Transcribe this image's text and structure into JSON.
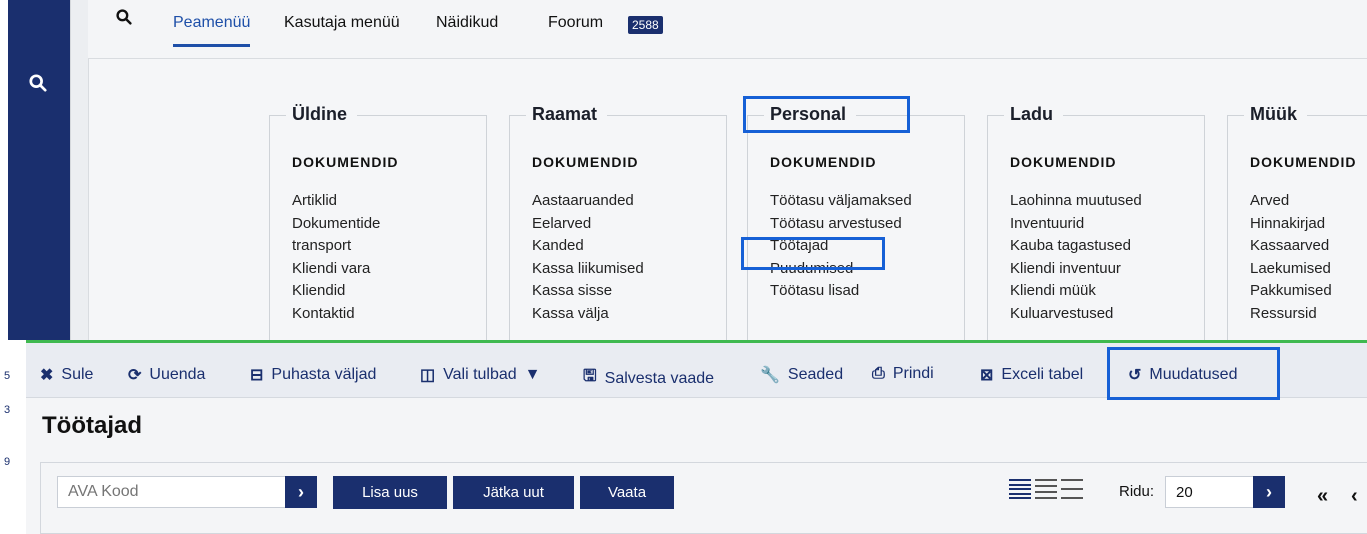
{
  "top_nav": {
    "tabs": [
      {
        "label": "Peamenüü"
      },
      {
        "label": "Kasutaja menüü"
      },
      {
        "label": "Näidikud"
      },
      {
        "label": "Foorum"
      }
    ],
    "badge": "2588"
  },
  "menu": {
    "columns": [
      {
        "title": "Üldine",
        "subtitle": "DOKUMENDID",
        "items": [
          "Artiklid",
          "Dokumentide",
          "transport",
          "Kliendi vara",
          "Kliendid",
          "Kontaktid"
        ]
      },
      {
        "title": "Raamat",
        "subtitle": "DOKUMENDID",
        "items": [
          "Aastaaruanded",
          "Eelarved",
          "Kanded",
          "Kassa liikumised",
          "Kassa sisse",
          "Kassa välja"
        ]
      },
      {
        "title": "Personal",
        "subtitle": "DOKUMENDID",
        "items": [
          "Töötasu väljamaksed",
          "Töötasu arvestused",
          "Töötajad",
          "Puudumised",
          "Töötasu lisad"
        ]
      },
      {
        "title": "Ladu",
        "subtitle": "DOKUMENDID",
        "items": [
          "Laohinna muutused",
          "Inventuurid",
          "Kauba tagastused",
          "Kliendi inventuur",
          "Kliendi müük",
          "Kuluarvestused"
        ]
      },
      {
        "title": "Müük",
        "subtitle": "DOKUMENDID",
        "items": [
          "Arved",
          "Hinnakirjad",
          "Kassaarved",
          "Laekumised",
          "Pakkumised",
          "Ressursid"
        ]
      }
    ]
  },
  "toolbar": {
    "close": "Sule",
    "refresh": "Uuenda",
    "clear": "Puhasta väljad",
    "columns": "Vali tulbad",
    "save_view": "Salvesta vaade",
    "settings": "Seaded",
    "print": "Prindi",
    "excel": "Exceli tabel",
    "changes": "Muudatused"
  },
  "page": {
    "title": "Töötajad",
    "code_placeholder": "AVA Kood",
    "add_new": "Lisa uus",
    "continue_new": "Jätka uut",
    "view": "Vaata",
    "rows_label": "Ridu:",
    "rows_value": "20",
    "pager_first": "«",
    "pager_prev": "‹"
  },
  "left_marks": [
    "5",
    "3",
    "9"
  ],
  "colors": {
    "navy": "#1a2f6e",
    "accent_blue": "#1660d6",
    "green_line": "#3fb950"
  }
}
